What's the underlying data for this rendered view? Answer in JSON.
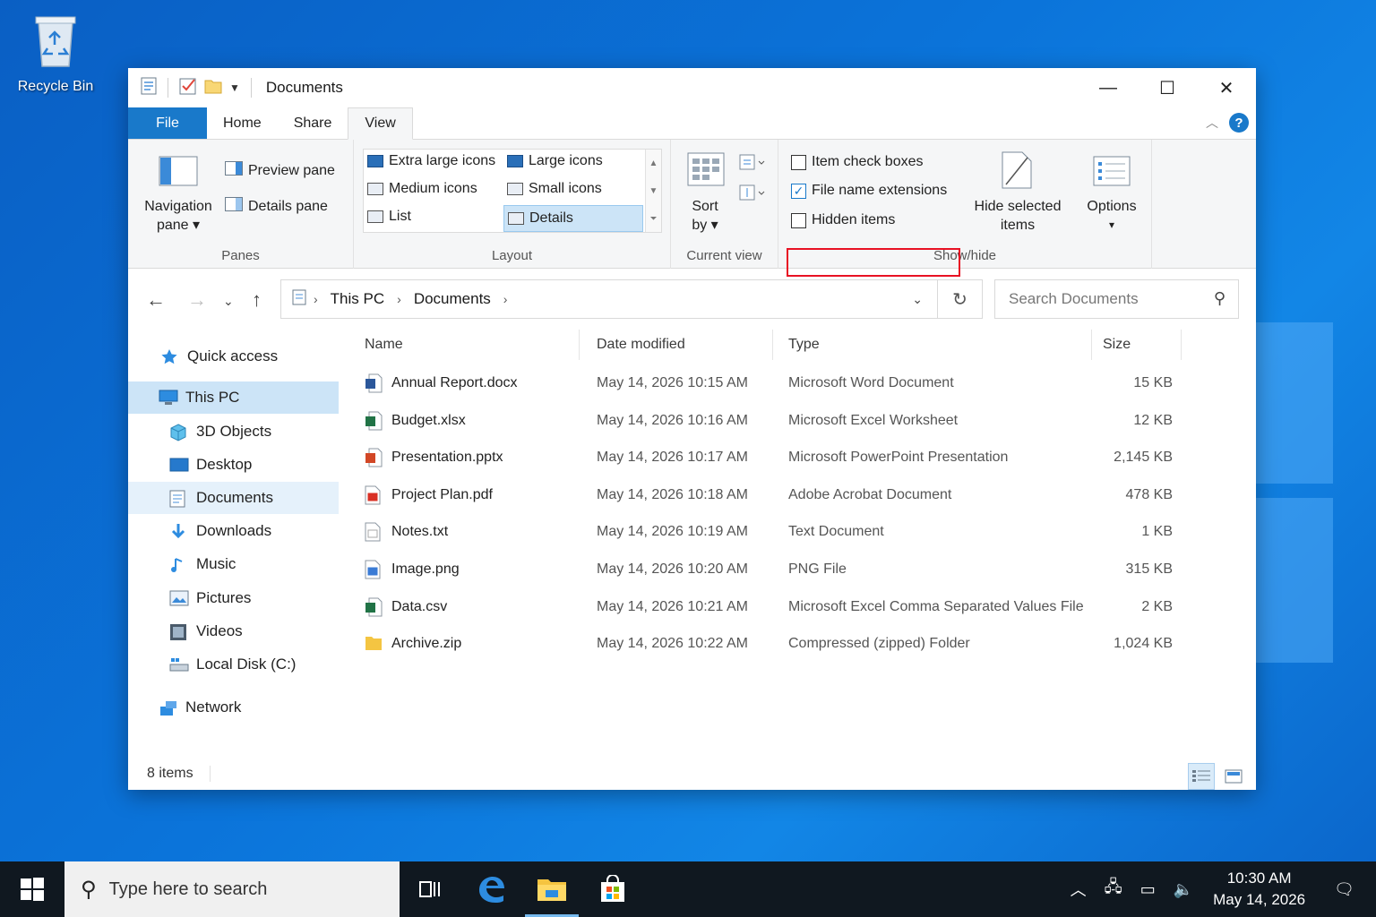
{
  "desktop": {
    "recycle_bin_label": "Recycle Bin"
  },
  "window": {
    "title": "Documents",
    "controls": {
      "minimize": "—",
      "maximize": "☐",
      "close": "✕"
    }
  },
  "ribbon_tabs": [
    "File",
    "Home",
    "Share",
    "View"
  ],
  "ribbon": {
    "panes": {
      "navigation_pane_line1": "Navigation",
      "navigation_pane_line2": "pane ▾",
      "preview_pane": "Preview pane",
      "details_pane": "Details pane",
      "group_label": "Panes"
    },
    "layout": {
      "extra_large_icons": "Extra large icons",
      "large_icons": "Large icons",
      "medium_icons": "Medium icons",
      "small_icons": "Small icons",
      "list": "List",
      "details": "Details",
      "group_label": "Layout"
    },
    "current_view": {
      "sort_by_line1": "Sort",
      "sort_by_line2": "by ▾",
      "group_label": "Current view"
    },
    "show_hide": {
      "item_check_boxes": "Item check boxes",
      "item_check_boxes_checked": false,
      "file_name_extensions": "File name extensions",
      "file_name_extensions_checked": true,
      "hidden_items": "Hidden items",
      "hidden_items_checked": false,
      "hide_selected_line1": "Hide selected",
      "hide_selected_line2": "items",
      "group_label": "Show/hide"
    },
    "options": {
      "line1": "Options",
      "line2": "▾"
    }
  },
  "address": {
    "crumbs": [
      "This PC",
      "Documents"
    ],
    "search_placeholder": "Search Documents"
  },
  "nav_pane": [
    {
      "label": "Quick access",
      "icon": "star-icon"
    },
    {
      "label": "This PC",
      "icon": "computer-icon"
    },
    {
      "label": "3D Objects",
      "icon": "cube-icon"
    },
    {
      "label": "Desktop",
      "icon": "desktop-icon"
    },
    {
      "label": "Documents",
      "icon": "document-icon"
    },
    {
      "label": "Downloads",
      "icon": "download-icon"
    },
    {
      "label": "Music",
      "icon": "music-icon"
    },
    {
      "label": "Pictures",
      "icon": "pictures-icon"
    },
    {
      "label": "Videos",
      "icon": "videos-icon"
    },
    {
      "label": "Local Disk (C:)",
      "icon": "drive-icon"
    },
    {
      "label": "Network",
      "icon": "network-icon"
    }
  ],
  "columns": [
    "Name",
    "Date modified",
    "Type",
    "Size"
  ],
  "files": [
    {
      "name": "Annual Report.docx",
      "date": "May 14, 2026 10:15 AM",
      "type": "Microsoft Word Document",
      "size": "15 KB",
      "icon": "word-icon",
      "color": "#2b579a"
    },
    {
      "name": "Budget.xlsx",
      "date": "May 14, 2026 10:16 AM",
      "type": "Microsoft Excel Worksheet",
      "size": "12 KB",
      "icon": "excel-icon",
      "color": "#217346"
    },
    {
      "name": "Presentation.pptx",
      "date": "May 14, 2026 10:17 AM",
      "type": "Microsoft PowerPoint Presentation",
      "size": "2,145 KB",
      "icon": "powerpoint-icon",
      "color": "#d24726"
    },
    {
      "name": "Project Plan.pdf",
      "date": "May 14, 2026 10:18 AM",
      "type": "Adobe Acrobat Document",
      "size": "478 KB",
      "icon": "pdf-icon",
      "color": "#d93025"
    },
    {
      "name": "Notes.txt",
      "date": "May 14, 2026 10:19 AM",
      "type": "Text Document",
      "size": "1 KB",
      "icon": "text-file-icon",
      "color": "#888888"
    },
    {
      "name": "Image.png",
      "date": "May 14, 2026 10:20 AM",
      "type": "PNG File",
      "size": "315 KB",
      "icon": "image-file-icon",
      "color": "#3a7bd5"
    },
    {
      "name": "Data.csv",
      "date": "May 14, 2026 10:21 AM",
      "type": "Microsoft Excel Comma Separated Values File",
      "size": "2 KB",
      "icon": "csv-icon",
      "color": "#217346"
    },
    {
      "name": "Archive.zip",
      "date": "May 14, 2026 10:22 AM",
      "type": "Compressed (zipped) Folder",
      "size": "1,024 KB",
      "icon": "zip-folder-icon",
      "color": "#f4c542"
    }
  ],
  "status": {
    "item_count": "8 items"
  },
  "taskbar": {
    "search_placeholder": "Type here to search",
    "time": "10:30 AM",
    "date": "May 14, 2026"
  },
  "colors": {
    "accent": "#1979ca",
    "highlight_box": "#e81123",
    "selection": "#cce4f7"
  }
}
